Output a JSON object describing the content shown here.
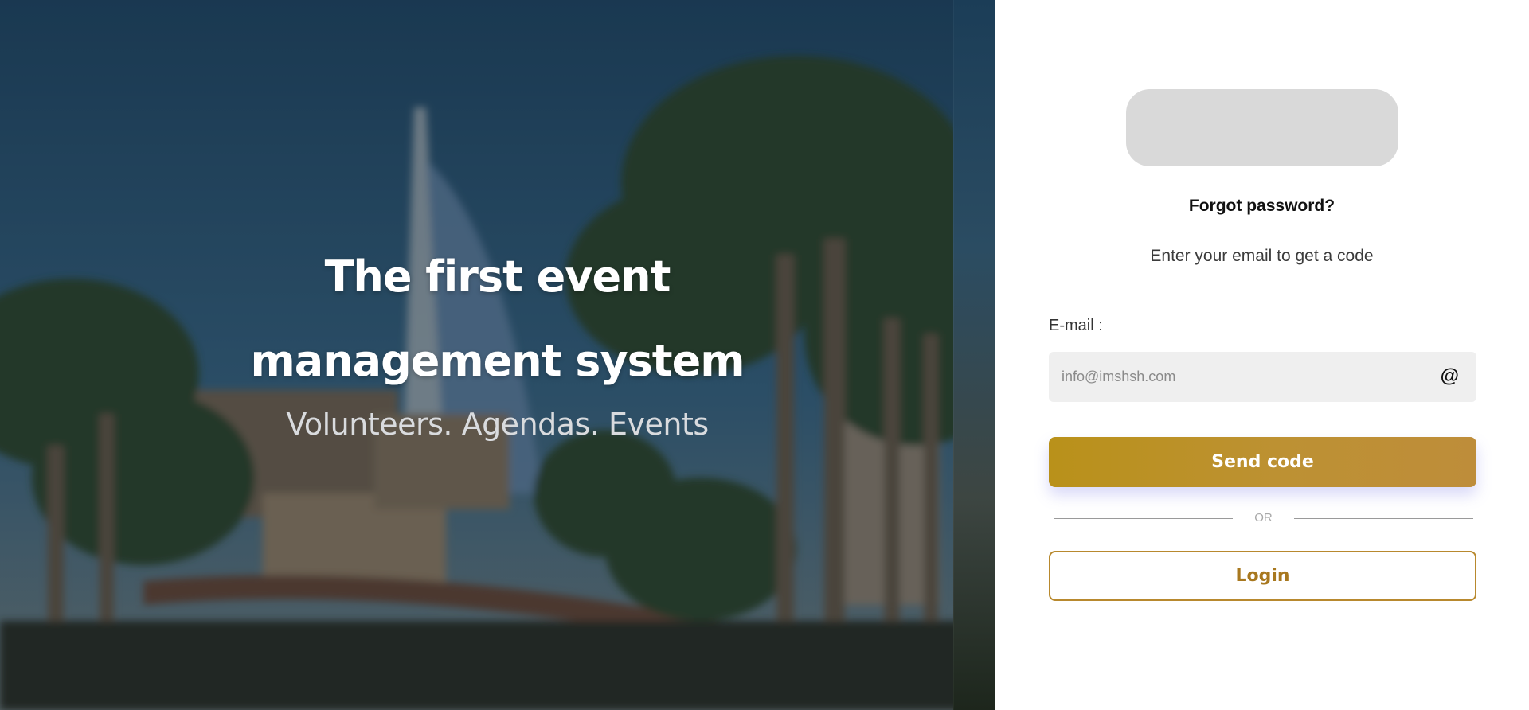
{
  "hero": {
    "title": "The first event management system",
    "subtitle": "Volunteers. Agendas. Events"
  },
  "form": {
    "heading": "Forgot password?",
    "subheading": "Enter your email to get a code",
    "email_label": "E-mail :",
    "email_placeholder": "info@imshsh.com",
    "email_value": "",
    "email_icon": "@",
    "send_label": "Send code",
    "divider_text": "OR",
    "login_label": "Login"
  },
  "colors": {
    "accent_gold": "#bd9133",
    "login_border": "#b8892e",
    "input_bg": "#efefef",
    "logo_placeholder": "#d9d9d9"
  },
  "icons": {
    "email_field_icon": "at-icon"
  }
}
